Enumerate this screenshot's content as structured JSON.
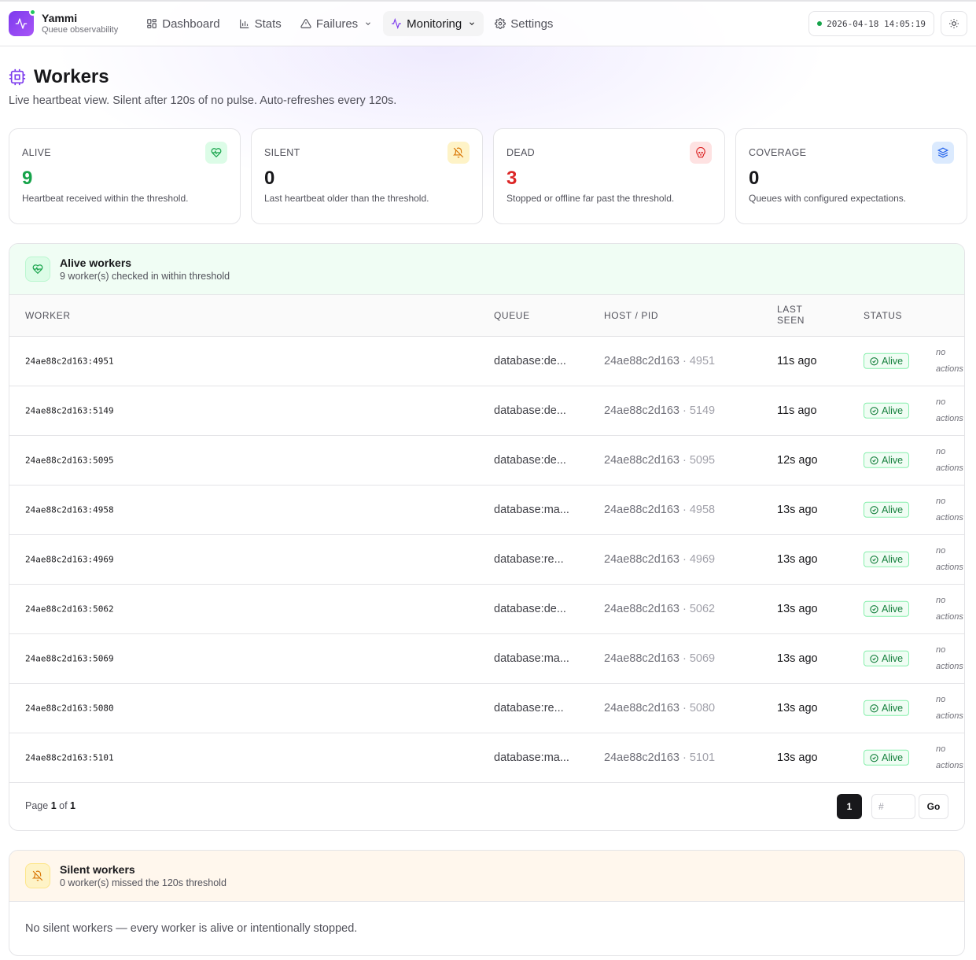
{
  "app": {
    "name": "Yammi",
    "subtitle": "Queue observability"
  },
  "nav": {
    "dashboard": "Dashboard",
    "stats": "Stats",
    "failures": "Failures",
    "monitoring": "Monitoring",
    "settings": "Settings"
  },
  "header": {
    "timestamp": "2026-04-18 14:05:19"
  },
  "page": {
    "title": "Workers",
    "subtitle": "Live heartbeat view. Silent after 120s of no pulse. Auto-refreshes every 120s."
  },
  "cards": [
    {
      "label": "ALIVE",
      "value": "9",
      "desc": "Heartbeat received within the threshold.",
      "icon": "heart-pulse-icon",
      "color": "#16a34a"
    },
    {
      "label": "SILENT",
      "value": "0",
      "desc": "Last heartbeat older than the threshold.",
      "icon": "bell-off-icon",
      "color": "#d97706"
    },
    {
      "label": "DEAD",
      "value": "3",
      "desc": "Stopped or offline far past the threshold.",
      "icon": "skull-icon",
      "color": "#dc2626"
    },
    {
      "label": "COVERAGE",
      "value": "0",
      "desc": "Queues with configured expectations.",
      "icon": "layers-icon",
      "color": "#2563eb"
    }
  ],
  "alive": {
    "title": "Alive workers",
    "subtitle": "9 worker(s) checked in within threshold",
    "columns": {
      "worker": "WORKER",
      "queue": "QUEUE",
      "host_pid": "HOST / PID",
      "last_seen_1": "LAST",
      "last_seen_2": "SEEN",
      "status": "STATUS"
    },
    "rows": [
      {
        "worker": "24ae88c2d163:4951",
        "queue": "database:de...",
        "host": "24ae88c2d163",
        "pid": "4951",
        "seen": "11s ago",
        "status": "Alive",
        "actions": "no actions"
      },
      {
        "worker": "24ae88c2d163:5149",
        "queue": "database:de...",
        "host": "24ae88c2d163",
        "pid": "5149",
        "seen": "11s ago",
        "status": "Alive",
        "actions": "no actions"
      },
      {
        "worker": "24ae88c2d163:5095",
        "queue": "database:de...",
        "host": "24ae88c2d163",
        "pid": "5095",
        "seen": "12s ago",
        "status": "Alive",
        "actions": "no actions"
      },
      {
        "worker": "24ae88c2d163:4958",
        "queue": "database:ma...",
        "host": "24ae88c2d163",
        "pid": "4958",
        "seen": "13s ago",
        "status": "Alive",
        "actions": "no actions"
      },
      {
        "worker": "24ae88c2d163:4969",
        "queue": "database:re...",
        "host": "24ae88c2d163",
        "pid": "4969",
        "seen": "13s ago",
        "status": "Alive",
        "actions": "no actions"
      },
      {
        "worker": "24ae88c2d163:5062",
        "queue": "database:de...",
        "host": "24ae88c2d163",
        "pid": "5062",
        "seen": "13s ago",
        "status": "Alive",
        "actions": "no actions"
      },
      {
        "worker": "24ae88c2d163:5069",
        "queue": "database:ma...",
        "host": "24ae88c2d163",
        "pid": "5069",
        "seen": "13s ago",
        "status": "Alive",
        "actions": "no actions"
      },
      {
        "worker": "24ae88c2d163:5080",
        "queue": "database:re...",
        "host": "24ae88c2d163",
        "pid": "5080",
        "seen": "13s ago",
        "status": "Alive",
        "actions": "no actions"
      },
      {
        "worker": "24ae88c2d163:5101",
        "queue": "database:ma...",
        "host": "24ae88c2d163",
        "pid": "5101",
        "seen": "13s ago",
        "status": "Alive",
        "actions": "no actions"
      }
    ],
    "pager": {
      "prefix": "Page",
      "current": "1",
      "of": "of",
      "total": "1",
      "button": "1",
      "input_placeholder": "#",
      "go": "Go"
    }
  },
  "silent": {
    "title": "Silent workers",
    "subtitle": "0 worker(s) missed the 120s threshold",
    "empty": "No silent workers — every worker is alive or intentionally stopped."
  }
}
